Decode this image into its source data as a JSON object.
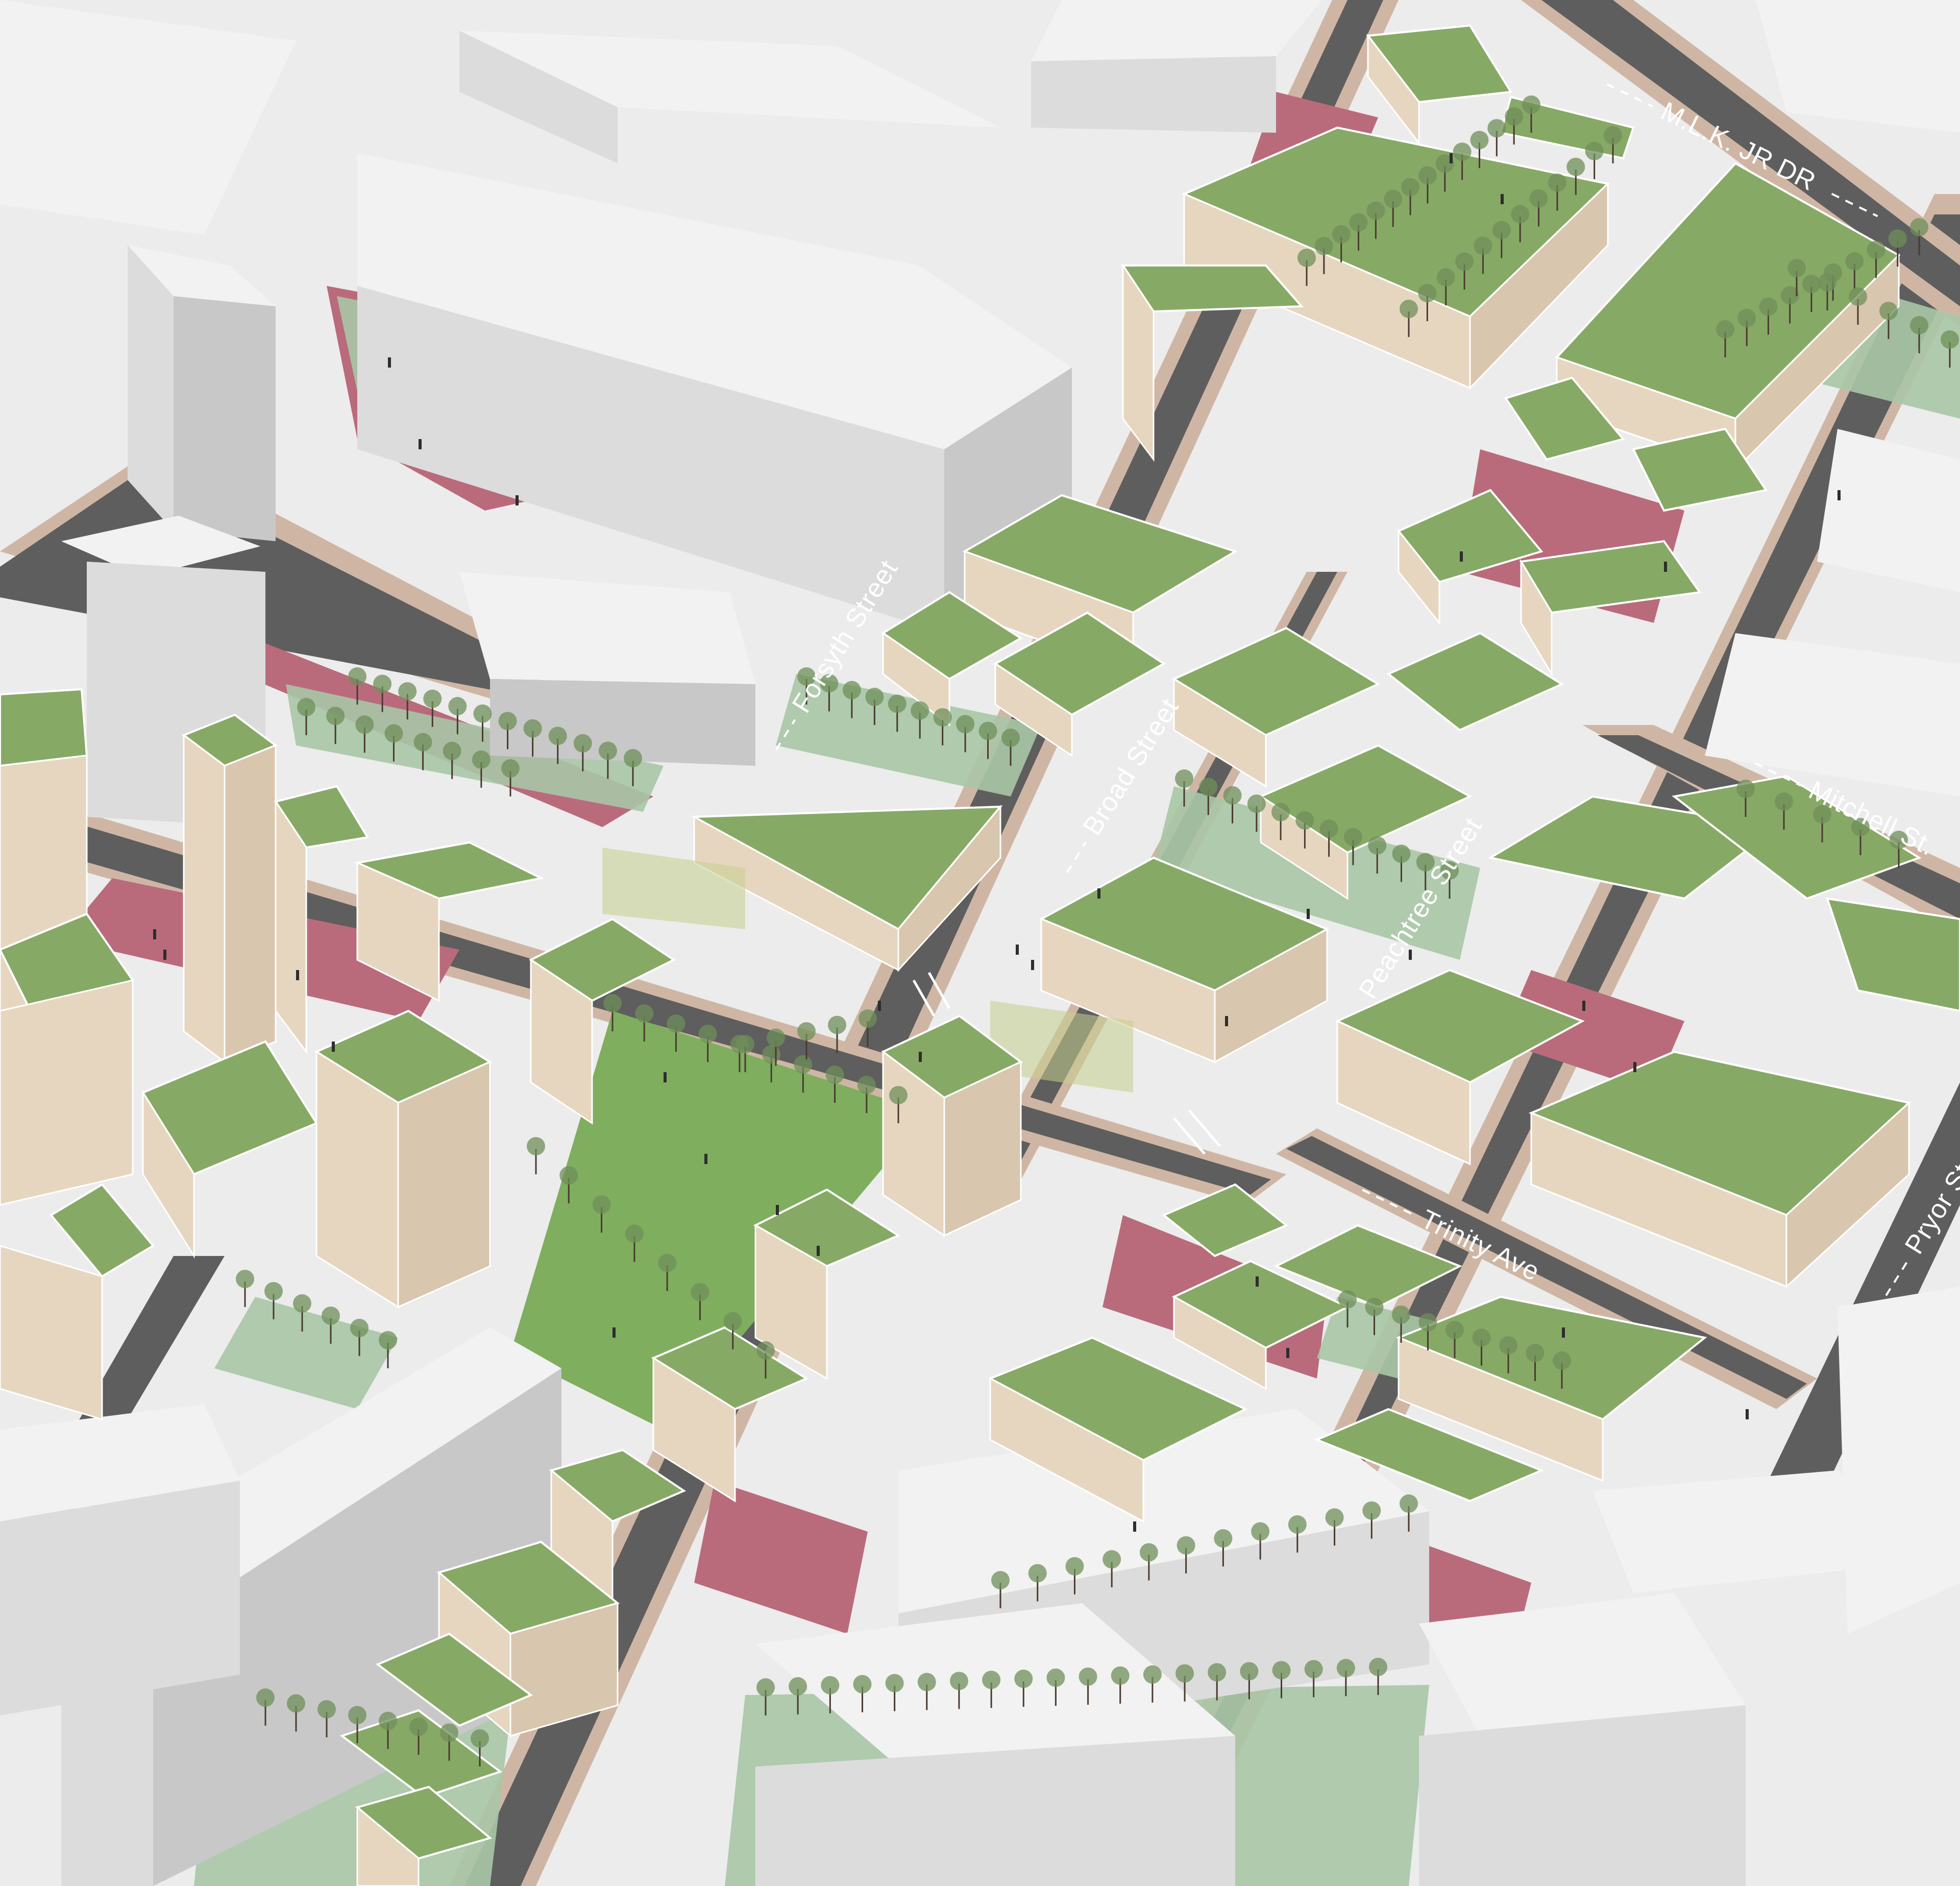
{
  "streets": [
    {
      "id": "forsyth",
      "label": "Forsyth Street"
    },
    {
      "id": "broad",
      "label": "Broad Street"
    },
    {
      "id": "peachtree",
      "label": "Peachtree Street"
    },
    {
      "id": "mlk",
      "label": "M.L.K. JR DR"
    },
    {
      "id": "mitchell",
      "label": "Mitchell St."
    },
    {
      "id": "trinity",
      "label": "Trinity Ave"
    },
    {
      "id": "pryor",
      "label": "Pryor St"
    }
  ],
  "colors": {
    "road": "#5e5e5e",
    "green_roof": "#87a966",
    "building_wall": "#e6d6c0",
    "plaza": "#b96b7c",
    "park": "#a9c6a6",
    "context_building": "#e4e4e4",
    "background": "#ececec"
  }
}
